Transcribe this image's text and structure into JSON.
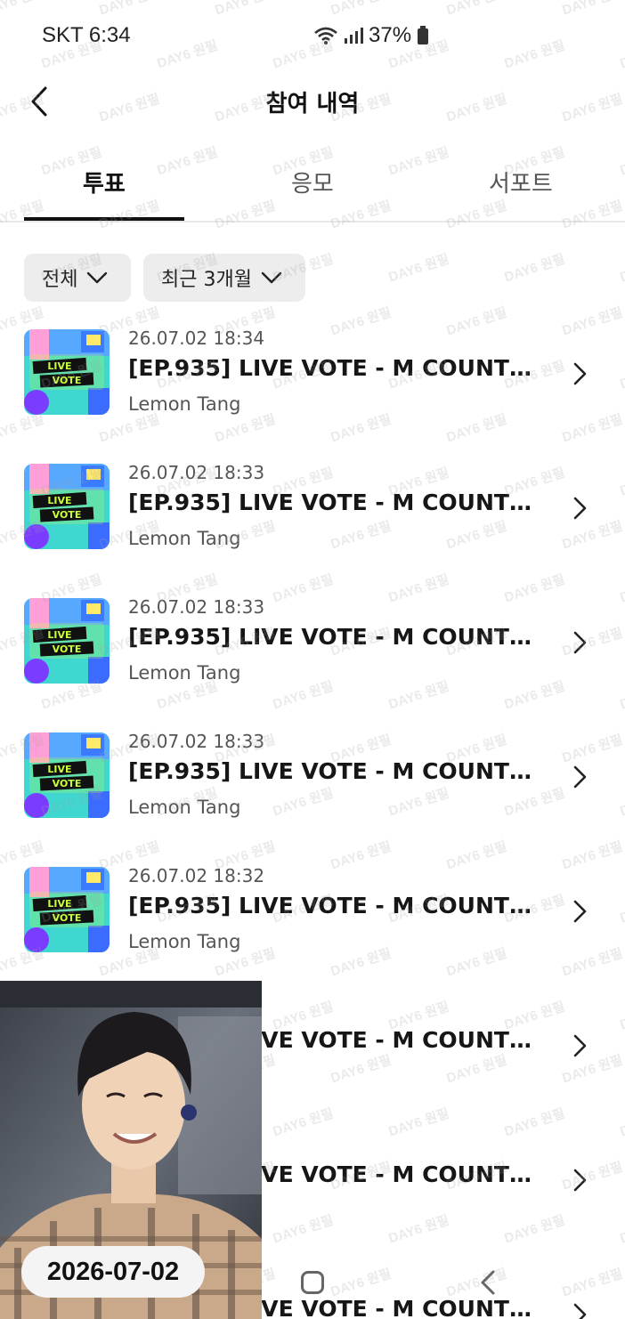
{
  "status_bar": {
    "carrier_time": "SKT 6:34",
    "battery": "37%"
  },
  "header": {
    "title": "참여 내역"
  },
  "tabs": [
    {
      "label": "투표",
      "active": true
    },
    {
      "label": "응모",
      "active": false
    },
    {
      "label": "서포트",
      "active": false
    }
  ],
  "filters": [
    {
      "label": "전체"
    },
    {
      "label": "최근 3개월"
    }
  ],
  "items": [
    {
      "date": "26.07.02 18:34",
      "title": "[EP.935] LIVE VOTE - M COUNTDO...",
      "author": "Lemon Tang"
    },
    {
      "date": "26.07.02 18:33",
      "title": "[EP.935] LIVE VOTE - M COUNTDO...",
      "author": "Lemon Tang"
    },
    {
      "date": "26.07.02 18:33",
      "title": "[EP.935] LIVE VOTE - M COUNTDO...",
      "author": "Lemon Tang"
    },
    {
      "date": "26.07.02 18:33",
      "title": "[EP.935] LIVE VOTE - M COUNTDO...",
      "author": "Lemon Tang"
    },
    {
      "date": "26.07.02 18:32",
      "title": "[EP.935] LIVE VOTE - M COUNTDO...",
      "author": "Lemon Tang"
    },
    {
      "date": "",
      "title": "[EP.935] LIVE VOTE - M COUNTDO...",
      "author": ""
    },
    {
      "date": "",
      "title": "[EP.935] LIVE VOTE - M COUNTDO...",
      "author": ""
    },
    {
      "date": "",
      "title": "[EP.935] LIVE VOTE - M COUNTDO...",
      "author": ""
    }
  ],
  "thumbnail": {
    "line1": "LIVE",
    "line2": "VOTE"
  },
  "overlay": {
    "date": "2026-07-02"
  },
  "watermark": {
    "text": "DAY6 원필"
  },
  "colors": {
    "accent": "#111111",
    "chip_bg": "#ededed",
    "thumb_teal": "#3fd7d0"
  }
}
